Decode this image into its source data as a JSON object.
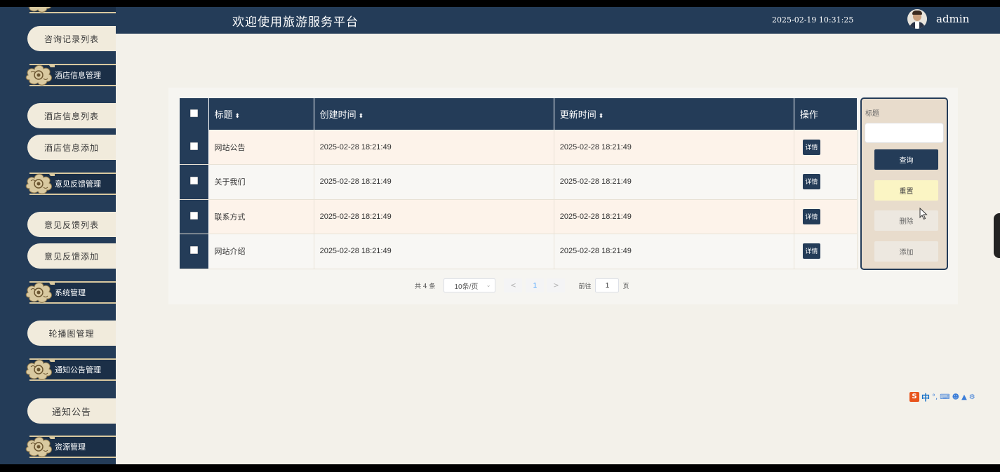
{
  "header": {
    "title": "欢迎使用旅游服务平台",
    "datetime": "2025-02-19 10:31:25",
    "username": "admin"
  },
  "sidebar": {
    "items": [
      {
        "type": "item",
        "label": "咨询记录列表"
      },
      {
        "type": "group",
        "label": "酒店信息管理"
      },
      {
        "type": "item",
        "label": "酒店信息列表"
      },
      {
        "type": "item",
        "label": "酒店信息添加"
      },
      {
        "type": "group",
        "label": "意见反馈管理"
      },
      {
        "type": "item",
        "label": "意见反馈列表"
      },
      {
        "type": "item",
        "label": "意见反馈添加"
      },
      {
        "type": "group",
        "label": "系统管理"
      },
      {
        "type": "item",
        "label": "轮播图管理"
      },
      {
        "type": "group",
        "label": "通知公告管理"
      },
      {
        "type": "item",
        "label": "通知公告"
      },
      {
        "type": "group",
        "label": "资源管理"
      }
    ]
  },
  "table": {
    "columns": {
      "title": "标题",
      "created": "创建时间",
      "updated": "更新时间",
      "operation": "操作"
    },
    "sort_glyph": "⬍",
    "detail_label": "详情",
    "rows": [
      {
        "title": "网站公告",
        "created": "2025-02-28 18:21:49",
        "updated": "2025-02-28 18:21:49"
      },
      {
        "title": "关于我们",
        "created": "2025-02-28 18:21:49",
        "updated": "2025-02-28 18:21:49"
      },
      {
        "title": "联系方式",
        "created": "2025-02-28 18:21:49",
        "updated": "2025-02-28 18:21:49"
      },
      {
        "title": "网站介绍",
        "created": "2025-02-28 18:21:49",
        "updated": "2025-02-28 18:21:49"
      }
    ]
  },
  "pagination": {
    "total_text": "共 4 条",
    "page_size": "10条/页",
    "prev": "<",
    "current_page": "1",
    "next": ">",
    "goto_label": "前往",
    "goto_value": "1",
    "page_unit": "页"
  },
  "search_panel": {
    "field_label": "标题",
    "field_value": "",
    "query_label": "查询",
    "reset_label": "重置",
    "delete_label": "删除",
    "add_label": "添加"
  },
  "ime_bar": {
    "logo": "S",
    "mode": "中"
  },
  "colors": {
    "navy": "#243c58",
    "cream": "#f1ebdc",
    "row_alt": "#fdf3ea",
    "reset_button": "#fbf5c4",
    "page_active": "#409eff"
  }
}
